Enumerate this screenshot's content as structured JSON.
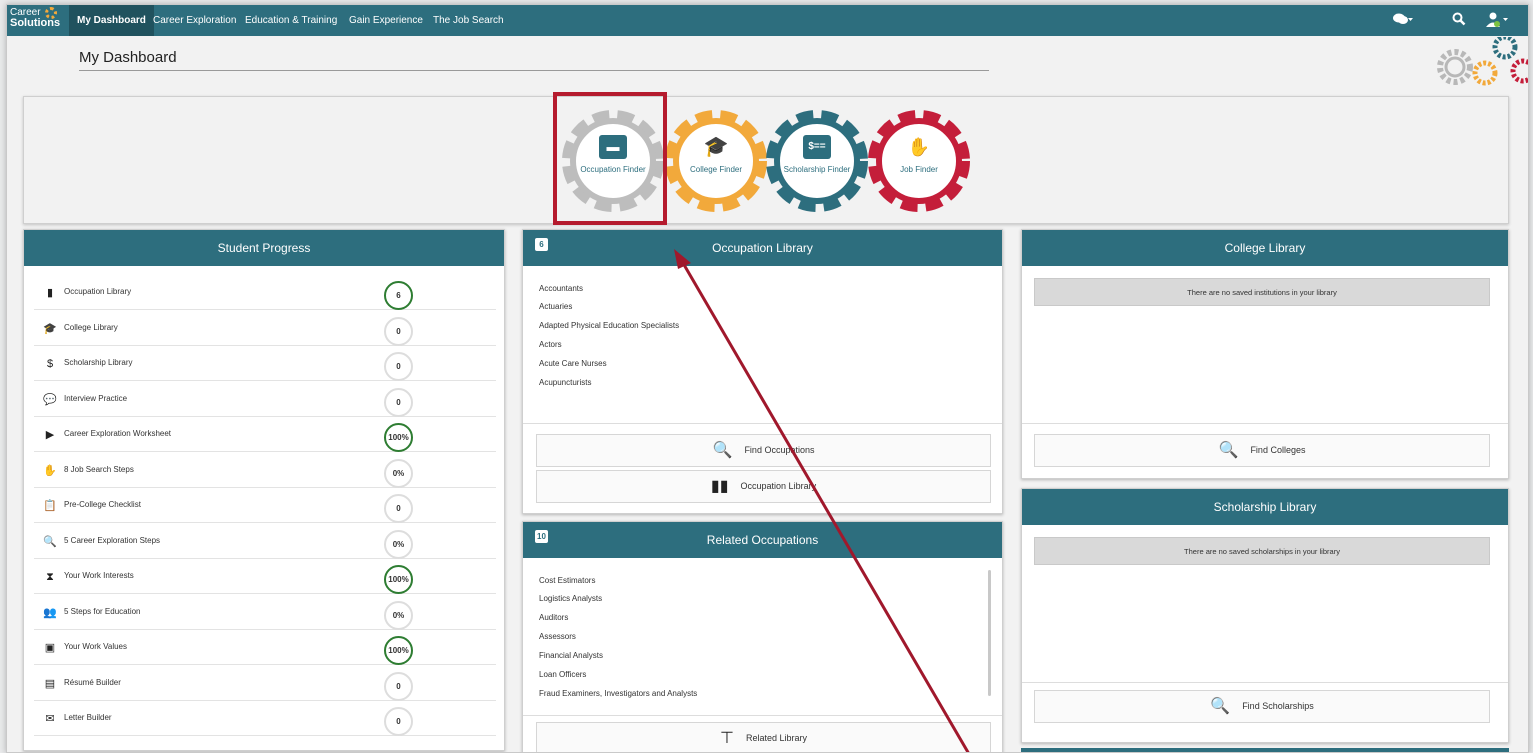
{
  "nav": {
    "logo_line1": "Career",
    "logo_line2": "Solutions",
    "items": [
      {
        "label": "My Dashboard"
      },
      {
        "label": "Career Exploration"
      },
      {
        "label": "Education & Training"
      },
      {
        "label": "Gain Experience"
      },
      {
        "label": "The Job Search"
      }
    ],
    "icons": {
      "chat": "chat-icon",
      "search": "search-icon",
      "user": "user-icon"
    }
  },
  "page": {
    "title": "My Dashboard"
  },
  "finders": [
    {
      "label": "Occupation Finder",
      "color": "#bdbdbd",
      "icon": "briefcase-icon",
      "glyph": "▬"
    },
    {
      "label": "College Finder",
      "color": "#f2a93b",
      "icon": "graduation-cap-icon",
      "glyph": "🎓"
    },
    {
      "label": "Scholarship Finder",
      "color": "#2d6e7e",
      "icon": "money-icon",
      "glyph": "$=="
    },
    {
      "label": "Job Finder",
      "color": "#c41e3a",
      "icon": "handshake-icon",
      "glyph": "✋"
    }
  ],
  "student_progress": {
    "title": "Student Progress",
    "rows": [
      {
        "label": "Occupation Library",
        "value": "6",
        "icon": "briefcase-icon",
        "done": true
      },
      {
        "label": "College Library",
        "value": "0",
        "icon": "graduation-cap-icon",
        "done": false
      },
      {
        "label": "Scholarship Library",
        "value": "0",
        "icon": "money-icon",
        "done": false
      },
      {
        "label": "Interview Practice",
        "value": "0",
        "icon": "chat-icon",
        "done": false
      },
      {
        "label": "Career Exploration Worksheet",
        "value": "100%",
        "icon": "play-circle-icon",
        "done": true
      },
      {
        "label": "8 Job Search Steps",
        "value": "0%",
        "icon": "handshake-icon",
        "done": false
      },
      {
        "label": "Pre-College Checklist",
        "value": "0",
        "icon": "clipboard-icon",
        "done": false
      },
      {
        "label": "5 Career Exploration Steps",
        "value": "0%",
        "icon": "search-icon",
        "done": false
      },
      {
        "label": "Your Work Interests",
        "value": "100%",
        "icon": "hourglass-icon",
        "done": true
      },
      {
        "label": "5 Steps for Education",
        "value": "0%",
        "icon": "users-icon",
        "done": false
      },
      {
        "label": "Your Work Values",
        "value": "100%",
        "icon": "badge-icon",
        "done": true
      },
      {
        "label": "Résumé Builder",
        "value": "0",
        "icon": "file-icon",
        "done": false
      },
      {
        "label": "Letter Builder",
        "value": "0",
        "icon": "envelope-icon",
        "done": false
      }
    ]
  },
  "occupation_library": {
    "title": "Occupation Library",
    "count": "6",
    "items": [
      "Accountants",
      "Actuaries",
      "Adapted Physical Education Specialists",
      "Actors",
      "Acute Care Nurses",
      "Acupuncturists"
    ],
    "find_button": "Find Occupations",
    "library_button": "Occupation Library"
  },
  "related_occupations": {
    "title": "Related Occupations",
    "count": "10",
    "items": [
      "Cost Estimators",
      "Logistics Analysts",
      "Auditors",
      "Assessors",
      "Financial Analysts",
      "Loan Officers",
      "Fraud Examiners, Investigators and Analysts"
    ],
    "library_button": "Related Library"
  },
  "college_library": {
    "title": "College Library",
    "empty_message": "There are no saved institutions in your library",
    "find_button": "Find Colleges"
  },
  "scholarship_library": {
    "title": "Scholarship Library",
    "empty_message": "There are no saved scholarships in your library",
    "find_button": "Find Scholarships"
  },
  "colors": {
    "teal": "#2d6e7e",
    "highlight": "#b51b2e",
    "done_green": "#2e7d32"
  }
}
